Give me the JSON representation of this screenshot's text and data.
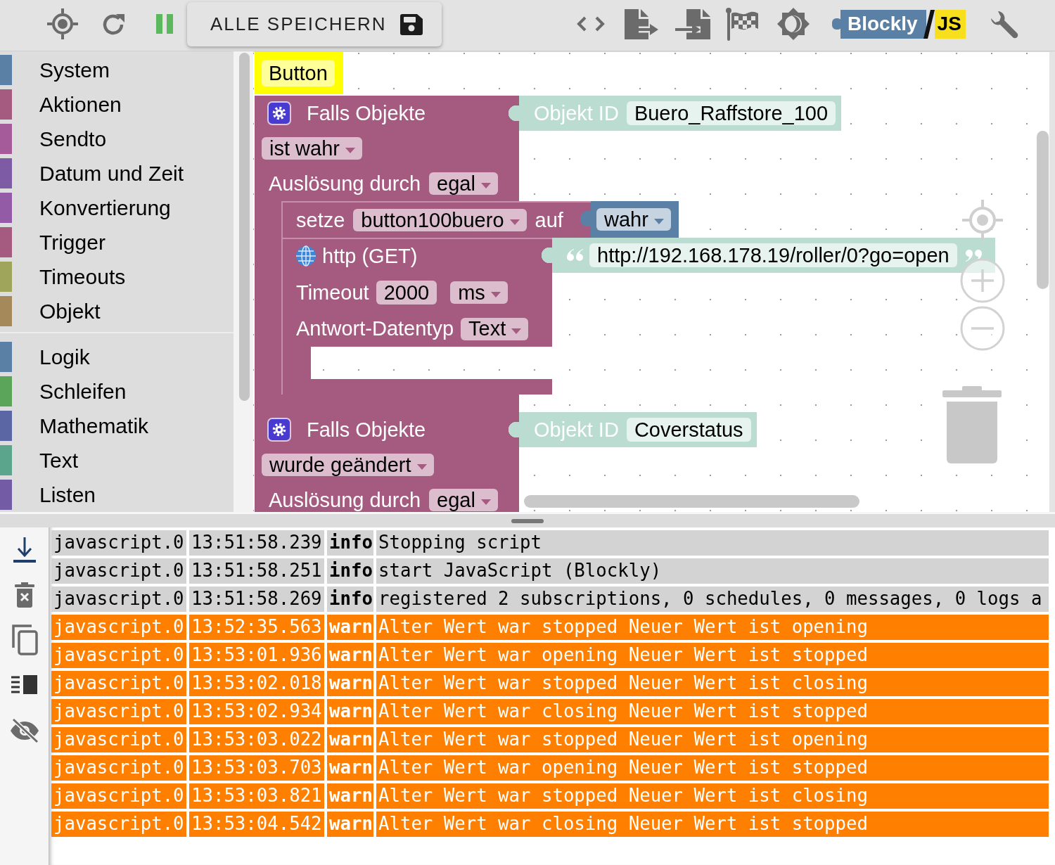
{
  "toolbar": {
    "save_button": {
      "label": "ALLE SPEICHERN"
    },
    "logo": {
      "name": "Blockly",
      "suffix": "JS"
    }
  },
  "sidebar": {
    "groups": [
      {
        "items": [
          {
            "label": "System",
            "color": "#5b80a5"
          },
          {
            "label": "Aktionen",
            "color": "#a55b80"
          },
          {
            "label": "Sendto",
            "color": "#a55b99"
          },
          {
            "label": "Datum und Zeit",
            "color": "#7e5ba5"
          },
          {
            "label": "Konvertierung",
            "color": "#935ba5"
          },
          {
            "label": "Trigger",
            "color": "#a55b80"
          },
          {
            "label": "Timeouts",
            "color": "#9fa55b"
          },
          {
            "label": "Objekt",
            "color": "#a5895b"
          }
        ]
      },
      {
        "items": [
          {
            "label": "Logik",
            "color": "#5b80a5"
          },
          {
            "label": "Schleifen",
            "color": "#5ba55b"
          },
          {
            "label": "Mathematik",
            "color": "#5b67a5"
          },
          {
            "label": "Text",
            "color": "#5ba58c"
          },
          {
            "label": "Listen",
            "color": "#745ba5"
          }
        ]
      }
    ]
  },
  "workspace": {
    "blocks": [
      {
        "kind": "comment",
        "text": "Button"
      },
      {
        "kind": "trigger",
        "title": "Falls Objekte",
        "object": {
          "label": "Objekt ID",
          "value": "Buero_Raffstore_100"
        },
        "condition": "ist wahr",
        "source_label": "Auslösung durch",
        "source": "egal",
        "statements": [
          {
            "kind": "set",
            "label": "setze",
            "variable": "button100buero",
            "to_label": "auf",
            "value": "wahr"
          },
          {
            "kind": "http",
            "title": "http (GET)",
            "url": "http://192.168.178.19/roller/0?go=open",
            "timeout_label": "Timeout",
            "timeout": "2000",
            "unit": "ms",
            "type_label": "Antwort-Datentyp",
            "type": "Text"
          }
        ]
      },
      {
        "kind": "trigger",
        "title": "Falls Objekte",
        "object": {
          "label": "Objekt ID",
          "value": "Coverstatus"
        },
        "condition": "wurde geändert",
        "source_label": "Auslösung durch",
        "source": "egal"
      }
    ]
  },
  "log": {
    "rows": [
      {
        "source": "javascript.0",
        "time": "13:51:58.239",
        "severity": "info",
        "message": "Stopping script"
      },
      {
        "source": "javascript.0",
        "time": "13:51:58.251",
        "severity": "info",
        "message": "start JavaScript (Blockly)"
      },
      {
        "source": "javascript.0",
        "time": "13:51:58.269",
        "severity": "info",
        "message": "registered 2 subscriptions, 0 schedules, 0 messages, 0 logs a"
      },
      {
        "source": "javascript.0",
        "time": "13:52:35.563",
        "severity": "warn",
        "message": "Alter Wert war stopped Neuer Wert ist opening"
      },
      {
        "source": "javascript.0",
        "time": "13:53:01.936",
        "severity": "warn",
        "message": "Alter Wert war opening Neuer Wert ist stopped"
      },
      {
        "source": "javascript.0",
        "time": "13:53:02.018",
        "severity": "warn",
        "message": "Alter Wert war stopped Neuer Wert ist closing"
      },
      {
        "source": "javascript.0",
        "time": "13:53:02.934",
        "severity": "warn",
        "message": "Alter Wert war closing Neuer Wert ist stopped"
      },
      {
        "source": "javascript.0",
        "time": "13:53:03.022",
        "severity": "warn",
        "message": "Alter Wert war stopped Neuer Wert ist opening"
      },
      {
        "source": "javascript.0",
        "time": "13:53:03.703",
        "severity": "warn",
        "message": "Alter Wert war opening Neuer Wert ist stopped"
      },
      {
        "source": "javascript.0",
        "time": "13:53:03.821",
        "severity": "warn",
        "message": "Alter Wert war stopped Neuer Wert ist closing"
      },
      {
        "source": "javascript.0",
        "time": "13:53:04.542",
        "severity": "warn",
        "message": "Alter Wert war closing Neuer Wert ist stopped"
      }
    ]
  }
}
